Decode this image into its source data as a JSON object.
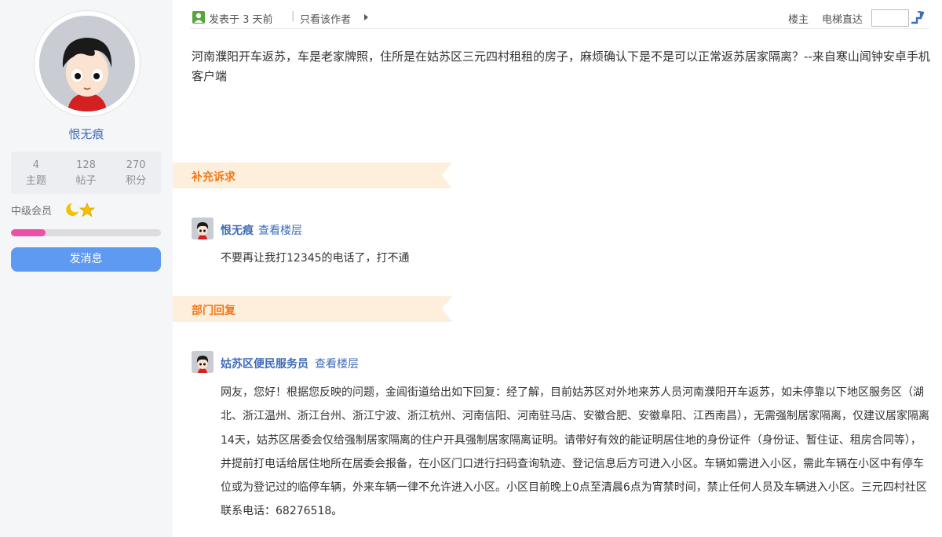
{
  "user": {
    "name": "恨无痕",
    "stats": [
      {
        "value": "4",
        "label": "主题"
      },
      {
        "value": "128",
        "label": "帖子"
      },
      {
        "value": "270",
        "label": "积分"
      }
    ],
    "level": "中级会员",
    "progress_fraction": 0.23,
    "message_button": "发消息"
  },
  "topbar": {
    "posted": "发表于 3 天前",
    "separator": "|",
    "author_only": "只看该作者",
    "owner": "楼主",
    "jump_label": "电梯直达",
    "jump_value": ""
  },
  "post": {
    "body": "河南濮阳开车返苏，车是老家牌照，住所是在姑苏区三元四村租租的房子，麻烦确认下是不是可以正常返苏居家隔离？--来自寒山闻钟安卓手机客户端"
  },
  "supplement": {
    "heading": "补充诉求",
    "author": "恨无痕",
    "view_floor": "查看楼层",
    "text": "不要再让我打12345的电话了，打不通"
  },
  "department": {
    "heading": "部门回复",
    "author": "姑苏区便民服务员",
    "view_floor": "查看楼层",
    "text": "网友，您好！根据您反映的问题，金阊街道给出如下回复：经了解，目前姑苏区对外地来苏人员河南濮阳开车返苏，如未停靠以下地区服务区（湖北、浙江温州、浙江台州、浙江宁波、浙江杭州、河南信阳、河南驻马店、安徽合肥、安徽阜阳、江西南昌），无需强制居家隔离，仅建议居家隔离14天，姑苏区居委会仅给强制居家隔离的住户开具强制居家隔离证明。请带好有效的能证明居住地的身份证件（身份证、暂住证、租房合同等），并提前打电话给居住地所在居委会报备，在小区门口进行扫码查询轨迹、登记信息后方可进入小区。车辆如需进入小区，需此车辆在小区中有停车位或为登记过的临停车辆，外来车辆一律不允许进入小区。小区目前晚上0点至清晨6点为宵禁时间，禁止任何人员及车辆进入小区。三元四村社区联系电话：68276518。"
  },
  "colors": {
    "accent_blue": "#3e6bb8",
    "banner_orange": "#f0791a",
    "banner_bg": "#fdefdc",
    "button_blue": "#5f9af2",
    "progress_pink": "#ee4fa7"
  }
}
